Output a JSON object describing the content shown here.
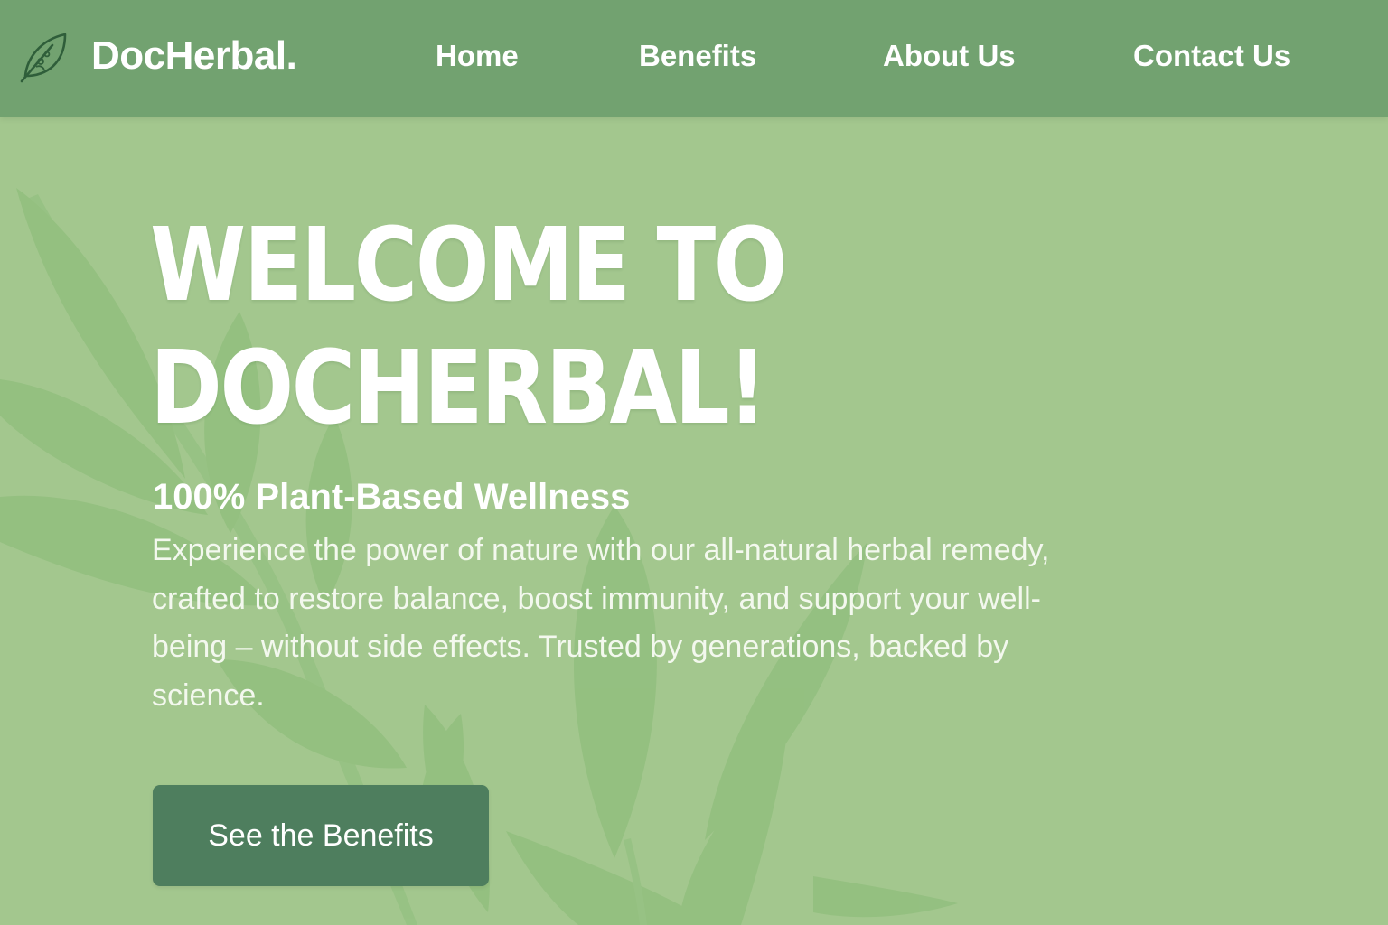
{
  "brand": {
    "name": "DocHerbal.",
    "logo_icon": "leaf-icon"
  },
  "nav": {
    "items": [
      {
        "label": "Home"
      },
      {
        "label": "Benefits"
      },
      {
        "label": "About Us"
      },
      {
        "label": "Contact Us"
      }
    ]
  },
  "hero": {
    "title_line1": "WELCOME TO",
    "title_line2": "DOCHERBAL!",
    "subtitle": "100% Plant-Based Wellness",
    "description": "Experience the power of nature with our all-natural herbal remedy, crafted to restore balance, boost immunity, and support your well-being – without side effects. Trusted by generations, backed by science.",
    "cta_label": "See the Benefits"
  },
  "colors": {
    "navbar": "#72a270",
    "background": "#a3c78e",
    "button": "#4e7e5e",
    "text": "#ffffff"
  }
}
